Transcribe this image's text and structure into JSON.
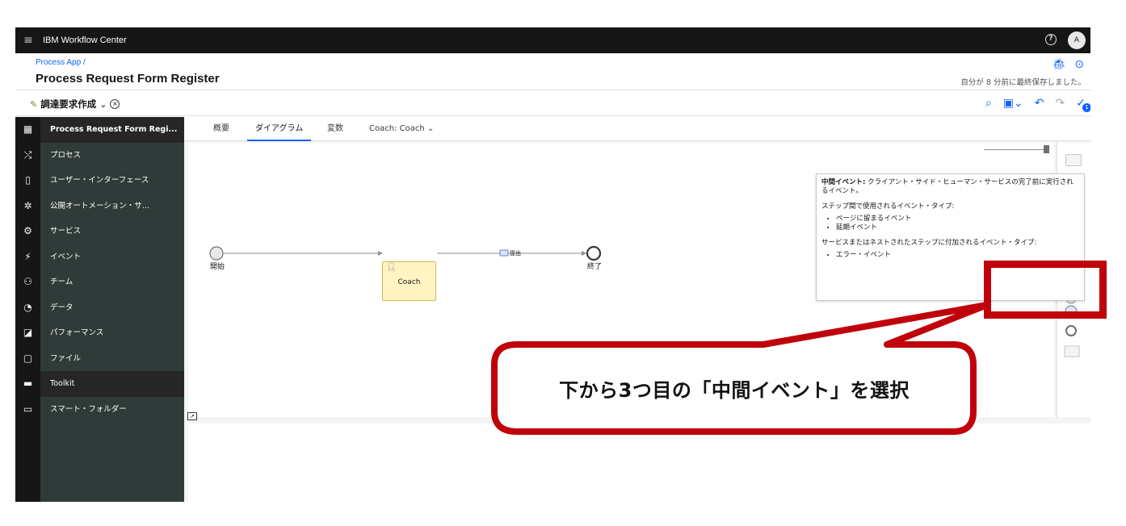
{
  "topbar": {
    "title": "IBM Workflow Center",
    "help": "?",
    "avatar": "A"
  },
  "header": {
    "breadcrumb": "Process App /",
    "app_name": "Process Request Form Register",
    "saved": "自分が 8 分前に最終保存しました。"
  },
  "subbar": {
    "process": "調達要求作成"
  },
  "nav": {
    "items": [
      {
        "label": "Process Request Form Regi...",
        "icon": "dashboard-icon"
      },
      {
        "label": "プロセス",
        "icon": "process-icon"
      },
      {
        "label": "ユーザー・インターフェース",
        "icon": "mobile-icon"
      },
      {
        "label": "公開オートメーション・サ...",
        "icon": "automation-icon"
      },
      {
        "label": "サービス",
        "icon": "gear-icon"
      },
      {
        "label": "イベント",
        "icon": "event-icon"
      },
      {
        "label": "チーム",
        "icon": "team-icon"
      },
      {
        "label": "データ",
        "icon": "data-icon"
      },
      {
        "label": "パフォーマンス",
        "icon": "performance-icon"
      },
      {
        "label": "ファイル",
        "icon": "file-icon"
      },
      {
        "label": "Toolkit",
        "icon": "toolkit-icon"
      },
      {
        "label": "スマート・フォルダー",
        "icon": "folder-icon"
      }
    ]
  },
  "tabs": {
    "overview": "概要",
    "diagram": "ダイアグラム",
    "variables": "変数",
    "coach": "Coach:  Coach"
  },
  "diagram": {
    "start": "開始",
    "coach": "Coach",
    "submit": "提出",
    "end": "終了"
  },
  "tooltip": {
    "title": "中間イベント:",
    "desc": " クライアント・サイド・ヒューマン・サービスの完了前に実行されるイベント。",
    "step_heading": "ステップ間で使用されるイベント・タイプ:",
    "step_items": [
      "ページに留まるイベント",
      "延期イベント"
    ],
    "attach_heading": "サービスまたはネストされたステップに付加されるイベント・タイプ:",
    "attach_items": [
      "エラー・イベント"
    ]
  },
  "callout": {
    "text": "下から3つ目の「中間イベント」を選択"
  },
  "colors": {
    "accent": "#0f62fe",
    "callout_red": "#c0000b",
    "coach_fill": "#fff4c2"
  }
}
